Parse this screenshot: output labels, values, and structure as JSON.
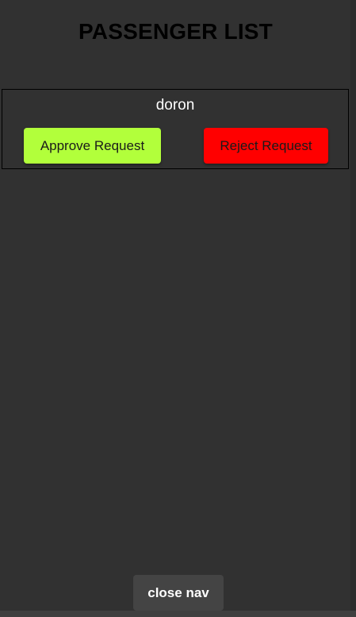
{
  "header": {
    "title": "PASSENGER LIST"
  },
  "passengers": [
    {
      "name": "doron",
      "approve_label": "Approve Request",
      "reject_label": "Reject Request"
    }
  ],
  "footer": {
    "close_nav_label": "close nav"
  },
  "colors": {
    "background": "#313131",
    "approve": "#b2ff3b",
    "reject": "#ff0000",
    "close_nav": "#444444"
  }
}
